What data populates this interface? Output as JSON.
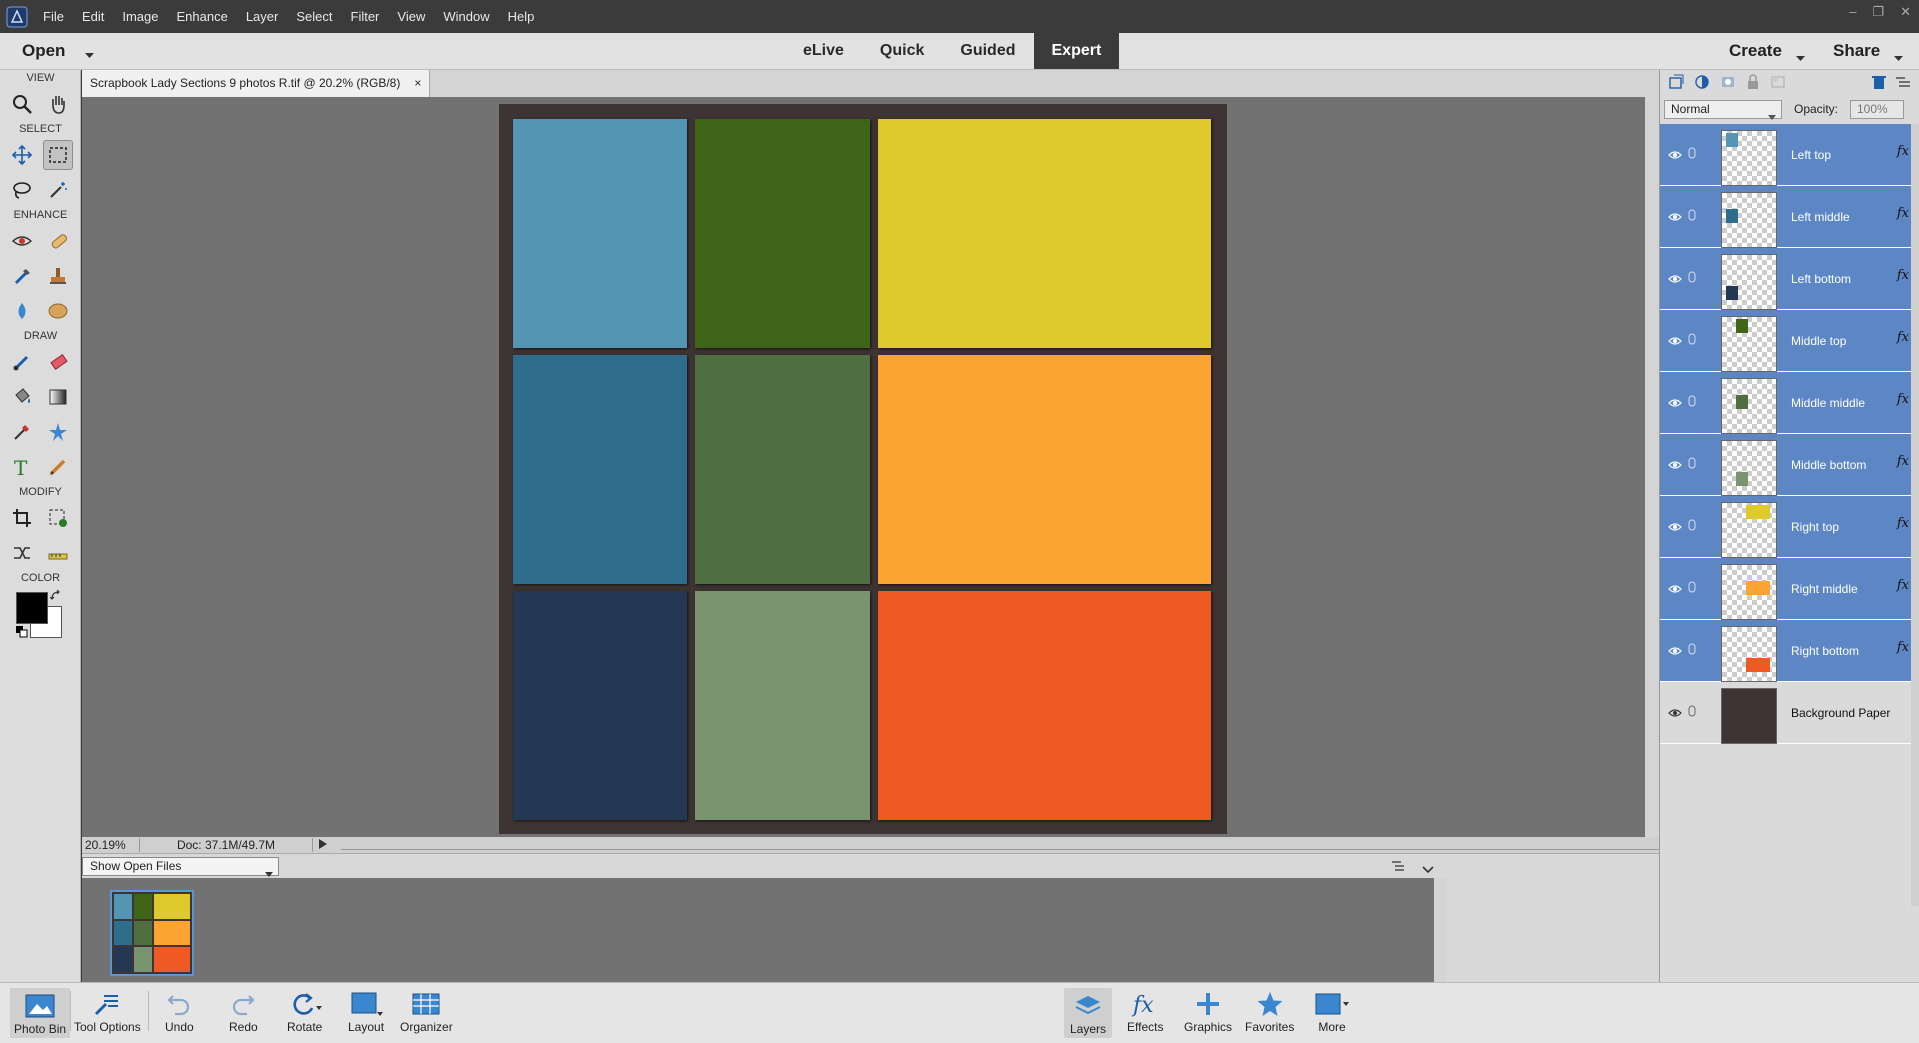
{
  "menubar": {
    "items": [
      "File",
      "Edit",
      "Image",
      "Enhance",
      "Layer",
      "Select",
      "Filter",
      "View",
      "Window",
      "Help"
    ]
  },
  "modebar": {
    "open_label": "Open",
    "tabs": [
      "eLive",
      "Quick",
      "Guided",
      "Expert"
    ],
    "active_tab": "Expert",
    "create_label": "Create",
    "share_label": "Share"
  },
  "toolbox": {
    "view_label": "VIEW",
    "select_label": "SELECT",
    "enhance_label": "ENHANCE",
    "draw_label": "DRAW",
    "modify_label": "MODIFY",
    "color_label": "COLOR"
  },
  "document": {
    "tab_title": "Scrapbook Lady Sections 9 photos R.tif @ 20.2% (RGB/8)",
    "close_glyph": "×",
    "zoom": "20.19%",
    "doc_size": "Doc: 37.1M/49.7M"
  },
  "canvas": {
    "paper_color": "#3f3434",
    "photos": [
      {
        "name": "Left top",
        "color": "#5495b4"
      },
      {
        "name": "Middle top",
        "color": "#3f6519"
      },
      {
        "name": "Right top",
        "color": "#dfca2e"
      },
      {
        "name": "Left middle",
        "color": "#2e6d8c"
      },
      {
        "name": "Middle middle",
        "color": "#4f6f41"
      },
      {
        "name": "Right middle",
        "color": "#fba433"
      },
      {
        "name": "Left bottom",
        "color": "#253853"
      },
      {
        "name": "Middle bottom",
        "color": "#7a9470"
      },
      {
        "name": "Right bottom",
        "color": "#ee5a22"
      }
    ]
  },
  "photobin": {
    "show_label": "Show Open Files"
  },
  "layers_panel": {
    "blend_mode": "Normal",
    "opacity_label": "Opacity:",
    "opacity_value": "100%",
    "fx_glyph": "fx",
    "layers": [
      {
        "name": "Left top",
        "color": "#5495b4",
        "selected": true
      },
      {
        "name": "Left middle",
        "color": "#2e6d8c",
        "selected": true
      },
      {
        "name": "Left bottom",
        "color": "#253853",
        "selected": true
      },
      {
        "name": "Middle top",
        "color": "#3f6519",
        "selected": true
      },
      {
        "name": "Middle middle",
        "color": "#4f6f41",
        "selected": true
      },
      {
        "name": "Middle bottom",
        "color": "#7a9470",
        "selected": true
      },
      {
        "name": "Right top",
        "color": "#dfca2e",
        "selected": true
      },
      {
        "name": "Right middle",
        "color": "#fba433",
        "selected": true
      },
      {
        "name": "Right bottom",
        "color": "#ee5a22",
        "selected": true
      },
      {
        "name": "Background Paper",
        "color": "#3f3434",
        "selected": false
      }
    ]
  },
  "taskbar": {
    "photo_bin": "Photo Bin",
    "tool_options": "Tool Options",
    "undo": "Undo",
    "redo": "Redo",
    "rotate": "Rotate",
    "layout": "Layout",
    "organizer": "Organizer",
    "layers": "Layers",
    "effects": "Effects",
    "graphics": "Graphics",
    "favorites": "Favorites",
    "more": "More"
  },
  "colors": {
    "accent": "#5d87c4",
    "foreground": "#000000",
    "background": "#ffffff"
  }
}
